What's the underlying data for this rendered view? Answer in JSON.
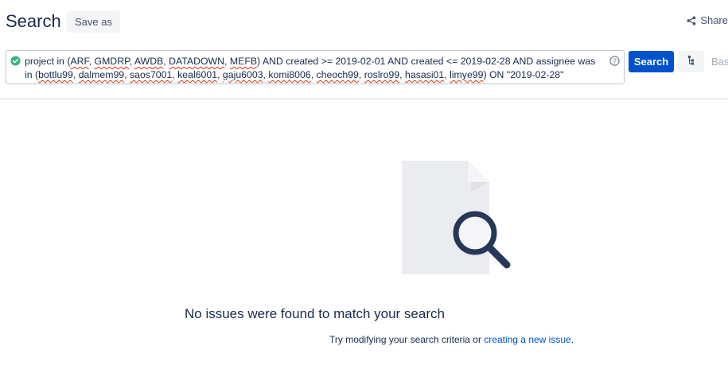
{
  "header": {
    "title": "Search",
    "save_as_label": "Save as",
    "share_label": "Share"
  },
  "jql": {
    "parts": [
      {
        "t": "project in (",
        "sq": false
      },
      {
        "t": "ARF",
        "sq": true
      },
      {
        "t": ", ",
        "sq": false
      },
      {
        "t": "GMDRP",
        "sq": true
      },
      {
        "t": ", ",
        "sq": false
      },
      {
        "t": "AWDB",
        "sq": true
      },
      {
        "t": ", ",
        "sq": false
      },
      {
        "t": "DATADOWN",
        "sq": true
      },
      {
        "t": ", ",
        "sq": false
      },
      {
        "t": "MEFB",
        "sq": true
      },
      {
        "t": ") AND created >= 2019-02-01 AND created <= 2019-02-28 AND assignee was in (",
        "sq": false
      },
      {
        "t": "bottlu99",
        "sq": true
      },
      {
        "t": ", ",
        "sq": false
      },
      {
        "t": "dalmem99",
        "sq": true
      },
      {
        "t": ", ",
        "sq": false
      },
      {
        "t": "saos7001",
        "sq": true
      },
      {
        "t": ", ",
        "sq": false
      },
      {
        "t": "keal6001",
        "sq": true
      },
      {
        "t": ", ",
        "sq": false
      },
      {
        "t": "gaju6003",
        "sq": true
      },
      {
        "t": ", ",
        "sq": false
      },
      {
        "t": "komi8006",
        "sq": true
      },
      {
        "t": ", ",
        "sq": false
      },
      {
        "t": "cheoch99",
        "sq": true
      },
      {
        "t": ", ",
        "sq": false
      },
      {
        "t": "roslro99",
        "sq": true
      },
      {
        "t": ", ",
        "sq": false
      },
      {
        "t": "hasasi01",
        "sq": true
      },
      {
        "t": ", ",
        "sq": false
      },
      {
        "t": "limye99",
        "sq": true
      },
      {
        "t": ") ON \"2019-02-28\"",
        "sq": false
      }
    ],
    "status_icon": "check-circle-icon",
    "help_icon": "question-circle-icon"
  },
  "actions": {
    "search_label": "Search",
    "switch_icon": "hierarchy-icon",
    "basic_label": "Basi"
  },
  "empty_state": {
    "illustration_icon": "document-search-icon",
    "title": "No issues were found to match your search",
    "subtitle_prefix": "Try modifying your search criteria or ",
    "link_text": "creating a new issue",
    "subtitle_suffix": "."
  },
  "colors": {
    "primary": "#0052cc",
    "text": "#172b4d",
    "valid": "#36b37e",
    "squiggle": "#de350b"
  }
}
